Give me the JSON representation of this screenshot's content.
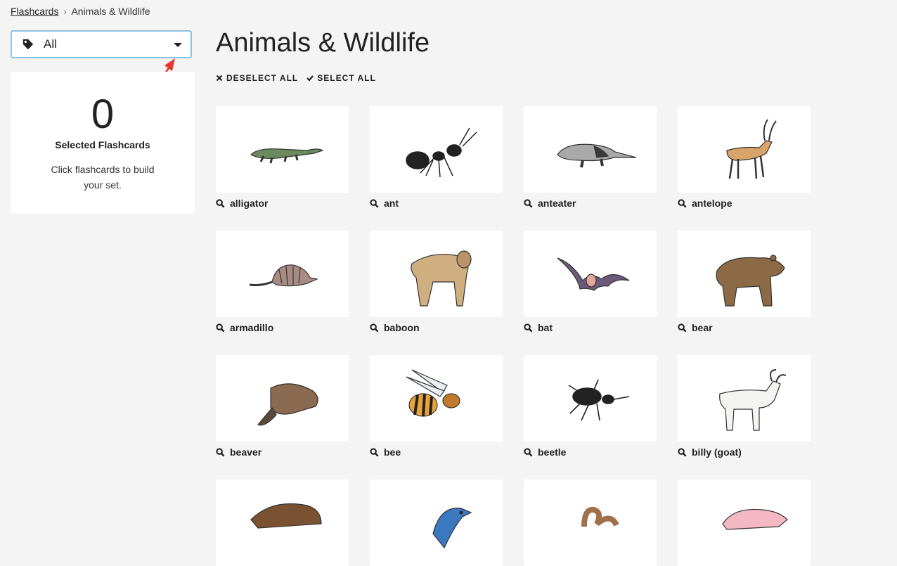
{
  "breadcrumb": {
    "root": "Flashcards",
    "current": "Animals & Wildlife"
  },
  "filter": {
    "label": "All"
  },
  "selected": {
    "count": "0",
    "title": "Selected Flashcards",
    "hint": "Click flashcards to build your set."
  },
  "page": {
    "title": "Animals & Wildlife"
  },
  "actions": {
    "deselect": "DESELECT ALL",
    "select": "SELECT ALL"
  },
  "cards": [
    {
      "label": "alligator"
    },
    {
      "label": "ant"
    },
    {
      "label": "anteater"
    },
    {
      "label": "antelope"
    },
    {
      "label": "armadillo"
    },
    {
      "label": "baboon"
    },
    {
      "label": "bat"
    },
    {
      "label": "bear"
    },
    {
      "label": "beaver"
    },
    {
      "label": "bee"
    },
    {
      "label": "beetle"
    },
    {
      "label": "billy (goat)"
    },
    {
      "label": ""
    },
    {
      "label": ""
    },
    {
      "label": ""
    },
    {
      "label": ""
    }
  ]
}
